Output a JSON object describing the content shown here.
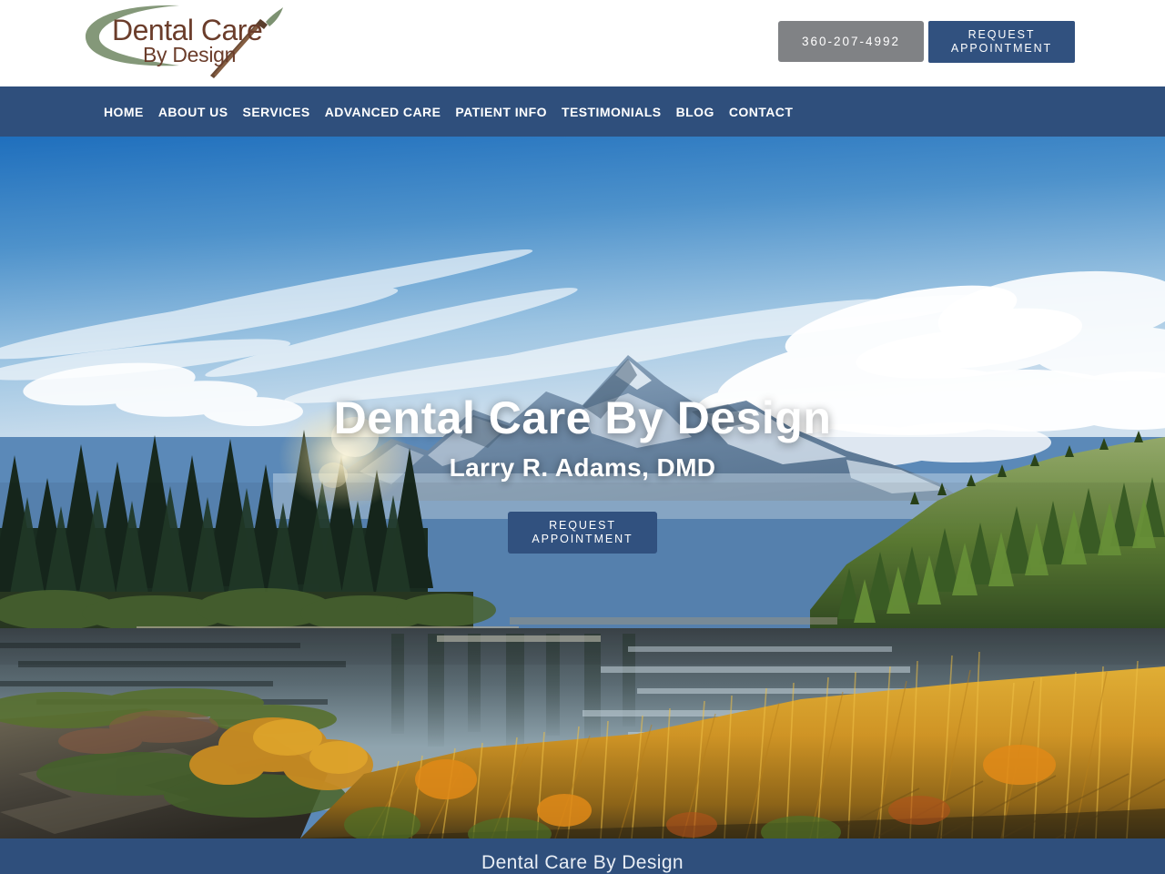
{
  "header": {
    "logo": {
      "line1": "Dental Care",
      "line2": "By Design",
      "swoosh_color": "#7d9272",
      "text_color": "#6b3d2b",
      "brush_handle_color": "#6b4a34",
      "brush_tip_color": "#7d9272"
    },
    "phone_button": {
      "label": "360-207-4992",
      "bg": "#808285"
    },
    "appointment_button": {
      "label": "REQUEST APPOINTMENT",
      "bg": "#31517f"
    }
  },
  "nav": {
    "bg": "#2f4f7c",
    "items": [
      {
        "label": "HOME"
      },
      {
        "label": "ABOUT US"
      },
      {
        "label": "SERVICES"
      },
      {
        "label": "ADVANCED CARE"
      },
      {
        "label": "PATIENT INFO"
      },
      {
        "label": "TESTIMONIALS"
      },
      {
        "label": "BLOG"
      },
      {
        "label": "CONTACT"
      }
    ]
  },
  "hero": {
    "title": "Dental Care By Design",
    "subtitle": "Larry R. Adams, DMD",
    "cta_label": "REQUEST APPOINTMENT",
    "cta_bg": "#31517f",
    "image_description": "Mount Shuksan reflected in Picture Lake with autumn grasses and evergreen forest",
    "colors": {
      "sky_top": "#2f7fc6",
      "sky_mid": "#7fb6e0",
      "sky_low": "#cfe2f2",
      "mountain": "#6f8ba6",
      "mountain_snow": "#dce8f2",
      "forest_dark": "#1d3326",
      "forest_lit": "#6a8f3f",
      "water": "#49545a",
      "grass_gold": "#d79c27",
      "grass_amber": "#b97d1d",
      "soil_dark": "#3a3630"
    }
  },
  "footer": {
    "bg": "#2f4f7c",
    "title": "Dental Care By Design"
  }
}
